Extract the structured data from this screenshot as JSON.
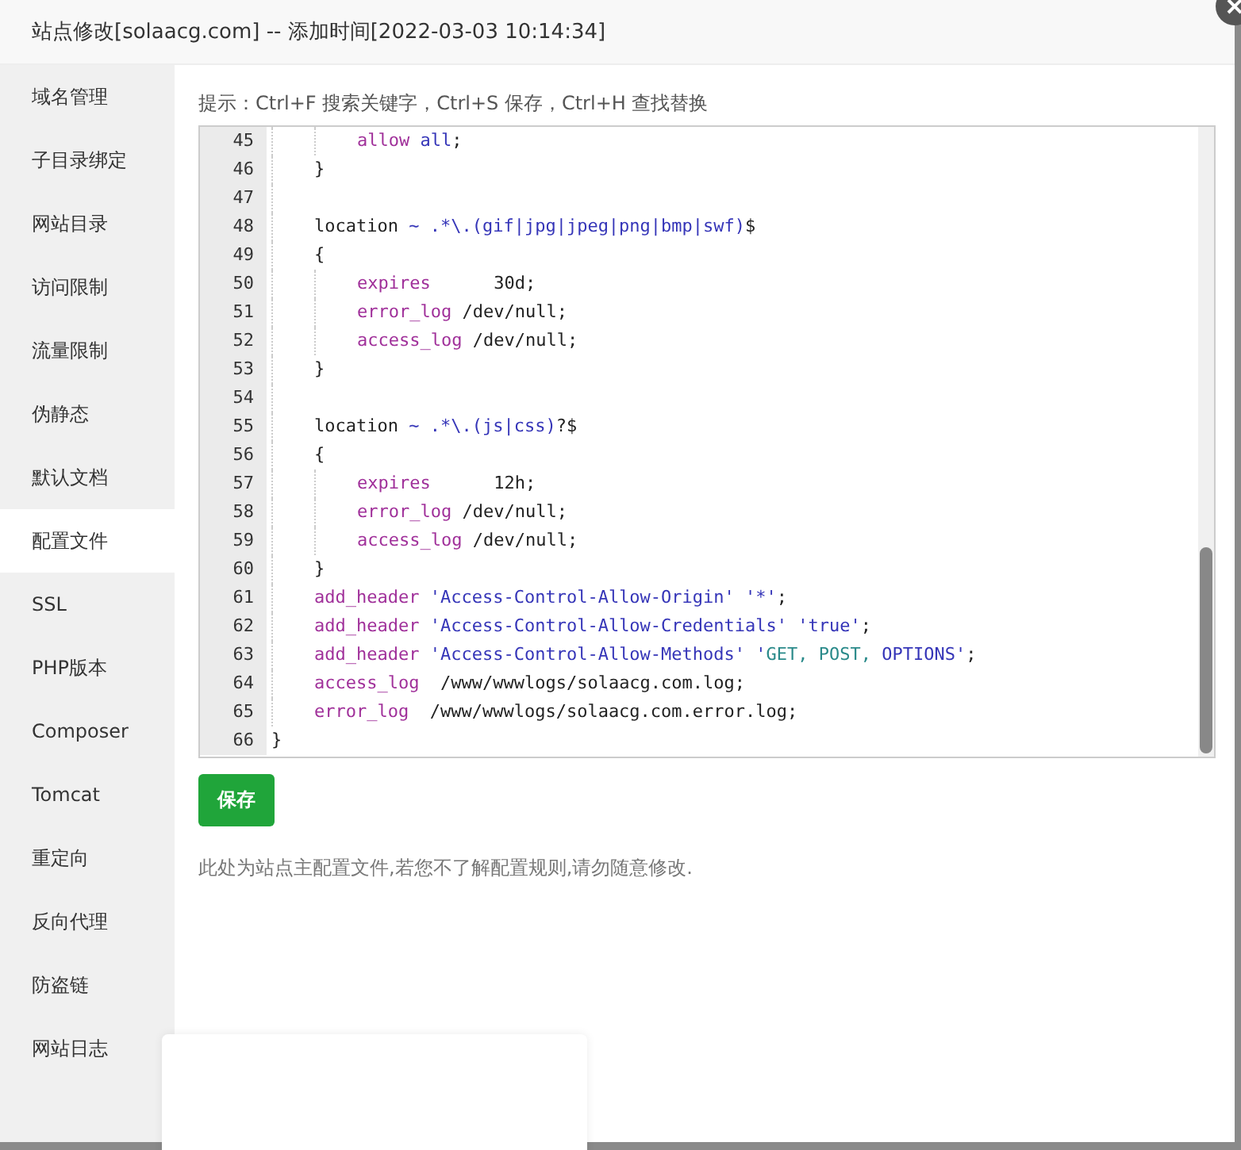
{
  "window": {
    "title": "站点修改[solaacg.com] -- 添加时间[2022-03-03 10:14:34]"
  },
  "sidebar": {
    "items": [
      {
        "label": "域名管理",
        "selected": false
      },
      {
        "label": "子目录绑定",
        "selected": false
      },
      {
        "label": "网站目录",
        "selected": false
      },
      {
        "label": "访问限制",
        "selected": false
      },
      {
        "label": "流量限制",
        "selected": false
      },
      {
        "label": "伪静态",
        "selected": false
      },
      {
        "label": "默认文档",
        "selected": false
      },
      {
        "label": "配置文件",
        "selected": true
      },
      {
        "label": "SSL",
        "selected": false
      },
      {
        "label": "PHP版本",
        "selected": false
      },
      {
        "label": "Composer",
        "selected": false
      },
      {
        "label": "Tomcat",
        "selected": false
      },
      {
        "label": "重定向",
        "selected": false
      },
      {
        "label": "反向代理",
        "selected": false
      },
      {
        "label": "防盗链",
        "selected": false
      },
      {
        "label": "网站日志",
        "selected": false
      }
    ]
  },
  "hint": "提示：Ctrl+F 搜索关键字，Ctrl+S 保存，Ctrl+H 查找替换",
  "editor": {
    "lines": [
      {
        "number": "45",
        "kind": "inner",
        "tokens": [
          {
            "kind": "keyword",
            "text": "allow"
          },
          {
            "kind": "value",
            "text": " all"
          },
          {
            "kind": "plain",
            "text": ";"
          }
        ]
      },
      {
        "number": "46",
        "kind": "block",
        "tokens": [
          {
            "kind": "plain",
            "text": "}"
          }
        ]
      },
      {
        "number": "47",
        "kind": "block"
      },
      {
        "number": "48",
        "kind": "block",
        "tokens": [
          {
            "kind": "plain",
            "text": "location"
          },
          {
            "kind": "value",
            "text": " ~ .*\\.(gif|jpg|jpeg|png|bmp|swf)"
          },
          {
            "kind": "plain",
            "text": "$"
          }
        ]
      },
      {
        "number": "49",
        "kind": "block",
        "tokens": [
          {
            "kind": "plain",
            "text": "{"
          }
        ]
      },
      {
        "number": "50",
        "kind": "inner",
        "tokens": [
          {
            "kind": "keyword",
            "text": "expires"
          },
          {
            "kind": "plain",
            "text": "      30d;"
          }
        ]
      },
      {
        "number": "51",
        "kind": "inner",
        "tokens": [
          {
            "kind": "keyword",
            "text": "error_log"
          },
          {
            "kind": "plain",
            "text": " /dev/null;"
          }
        ]
      },
      {
        "number": "52",
        "kind": "inner",
        "tokens": [
          {
            "kind": "keyword",
            "text": "access_log"
          },
          {
            "kind": "plain",
            "text": " /dev/null;"
          }
        ]
      },
      {
        "number": "53",
        "kind": "block",
        "tokens": [
          {
            "kind": "plain",
            "text": "}"
          }
        ]
      },
      {
        "number": "54",
        "kind": "block"
      },
      {
        "number": "55",
        "kind": "block",
        "tokens": [
          {
            "kind": "plain",
            "text": "location"
          },
          {
            "kind": "value",
            "text": " ~ .*\\.(js|css)"
          },
          {
            "kind": "plain",
            "text": "?$"
          }
        ]
      },
      {
        "number": "56",
        "kind": "block",
        "tokens": [
          {
            "kind": "plain",
            "text": "{"
          }
        ]
      },
      {
        "number": "57",
        "kind": "inner",
        "tokens": [
          {
            "kind": "keyword",
            "text": "expires"
          },
          {
            "kind": "plain",
            "text": "      12h;"
          }
        ]
      },
      {
        "number": "58",
        "kind": "inner",
        "tokens": [
          {
            "kind": "keyword",
            "text": "error_log"
          },
          {
            "kind": "plain",
            "text": " /dev/null;"
          }
        ]
      },
      {
        "number": "59",
        "kind": "inner",
        "tokens": [
          {
            "kind": "keyword",
            "text": "access_log"
          },
          {
            "kind": "plain",
            "text": " /dev/null;"
          }
        ]
      },
      {
        "number": "60",
        "kind": "block",
        "tokens": [
          {
            "kind": "plain",
            "text": "}"
          }
        ]
      },
      {
        "number": "61",
        "kind": "block",
        "tokens": [
          {
            "kind": "keyword",
            "text": "add_header"
          },
          {
            "kind": "value",
            "text": " 'Access-Control-Allow-Origin' '*'"
          },
          {
            "kind": "plain",
            "text": ";"
          }
        ]
      },
      {
        "number": "62",
        "kind": "block",
        "tokens": [
          {
            "kind": "keyword",
            "text": "add_header"
          },
          {
            "kind": "value",
            "text": " 'Access-Control-Allow-Credentials' 'true'"
          },
          {
            "kind": "plain",
            "text": ";"
          }
        ]
      },
      {
        "number": "63",
        "kind": "block",
        "tokens": [
          {
            "kind": "keyword",
            "text": "add_header"
          },
          {
            "kind": "value",
            "text": " 'Access-Control-Allow-Methods' '"
          },
          {
            "kind": "constant",
            "text": "GET, POST, "
          },
          {
            "kind": "value",
            "text": "OPTIONS'"
          },
          {
            "kind": "plain",
            "text": ";"
          }
        ]
      },
      {
        "number": "64",
        "kind": "block",
        "tokens": [
          {
            "kind": "keyword",
            "text": "access_log"
          },
          {
            "kind": "plain",
            "text": "  /www/wwwlogs/solaacg.com.log;"
          }
        ]
      },
      {
        "number": "65",
        "kind": "block",
        "tokens": [
          {
            "kind": "keyword",
            "text": "error_log"
          },
          {
            "kind": "plain",
            "text": "  /www/wwwlogs/solaacg.com.error.log;"
          }
        ]
      },
      {
        "number": "66",
        "kind": "top",
        "tokens": [
          {
            "kind": "plain",
            "text": "}"
          }
        ]
      }
    ]
  },
  "save_button": "保存",
  "note": "此处为站点主配置文件,若您不了解配置规则,请勿随意修改."
}
